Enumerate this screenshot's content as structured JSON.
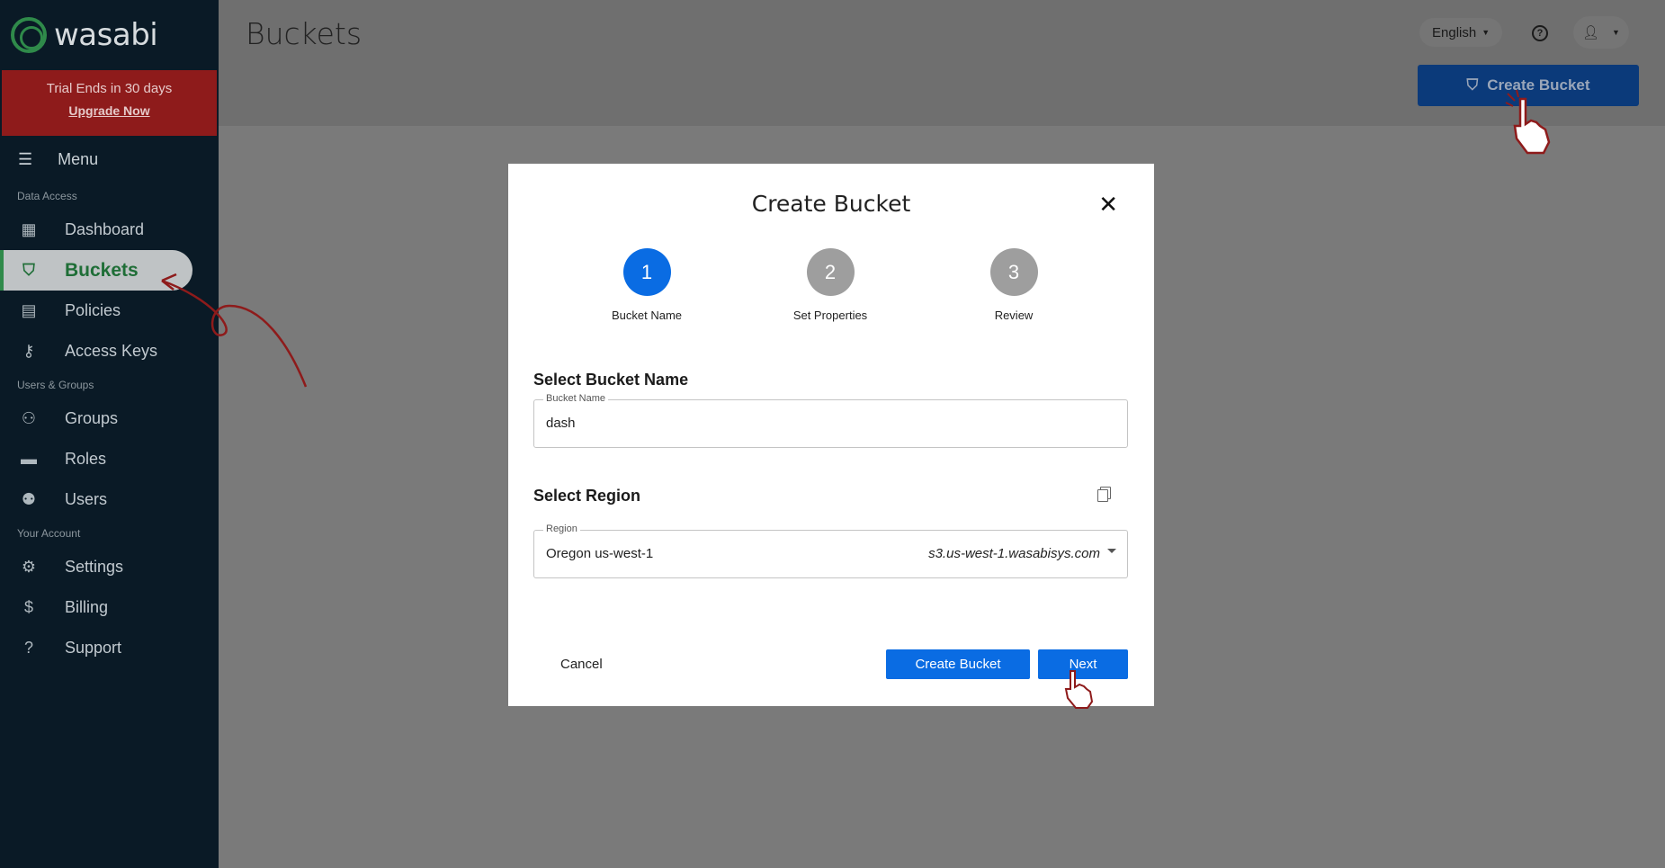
{
  "brand": {
    "name": "wasabi"
  },
  "trial": {
    "text": "Trial Ends in 30 days",
    "upgrade": "Upgrade Now"
  },
  "sidebar": {
    "menu_label": "Menu",
    "sections": [
      {
        "label": "Data Access"
      },
      {
        "label": "Users & Groups"
      },
      {
        "label": "Your Account"
      }
    ],
    "items": [
      {
        "label": "Dashboard",
        "icon": "dashboard-icon"
      },
      {
        "label": "Buckets",
        "icon": "bucket-icon",
        "active": true
      },
      {
        "label": "Policies",
        "icon": "policy-icon"
      },
      {
        "label": "Access Keys",
        "icon": "key-icon"
      },
      {
        "label": "Groups",
        "icon": "groups-icon"
      },
      {
        "label": "Roles",
        "icon": "roles-icon"
      },
      {
        "label": "Users",
        "icon": "users-icon"
      },
      {
        "label": "Settings",
        "icon": "gear-icon"
      },
      {
        "label": "Billing",
        "icon": "dollar-icon"
      },
      {
        "label": "Support",
        "icon": "help-icon"
      }
    ]
  },
  "header": {
    "title": "Buckets",
    "language": "English",
    "create_button": "Create Bucket"
  },
  "modal": {
    "title": "Create Bucket",
    "steps": [
      {
        "number": "1",
        "label": "Bucket Name"
      },
      {
        "number": "2",
        "label": "Set Properties"
      },
      {
        "number": "3",
        "label": "Review"
      }
    ],
    "bucket_section": "Select Bucket Name",
    "bucket_field": {
      "label": "Bucket Name",
      "value": "dash"
    },
    "region_section": "Select Region",
    "region_field": {
      "label": "Region",
      "value": "Oregon us-west-1",
      "endpoint": "s3.us-west-1.wasabisys.com"
    },
    "cancel": "Cancel",
    "create": "Create Bucket",
    "next": "Next"
  },
  "colors": {
    "accent": "#0a6ce3",
    "sidebar_bg": "#0a1a26",
    "brand_green": "#2f8a4a",
    "trial_bg": "#8e1b1b"
  }
}
